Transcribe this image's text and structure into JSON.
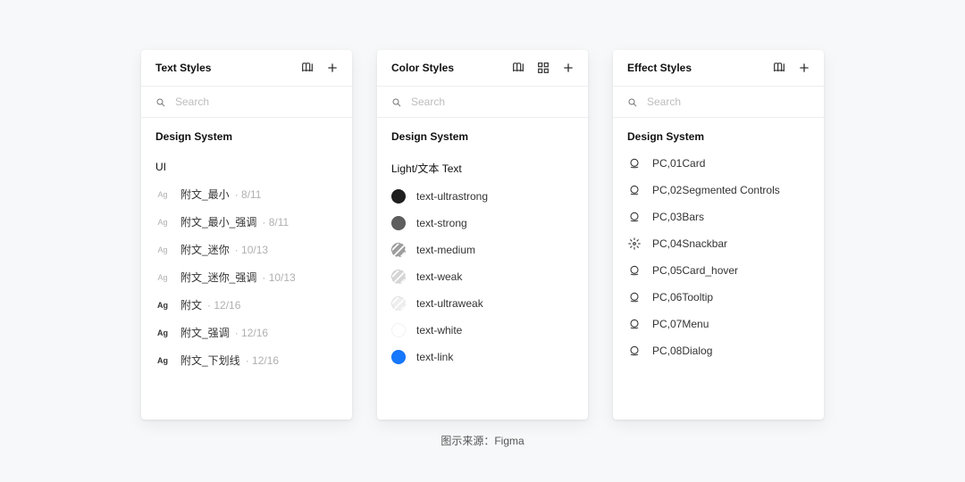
{
  "caption": "图示来源：Figma",
  "panels": {
    "text": {
      "title": "Text Styles",
      "searchPlaceholder": "Search",
      "section": "Design System",
      "group": "UI",
      "items": [
        {
          "name": "附文_最小",
          "meta": "8/11",
          "strong": false
        },
        {
          "name": "附文_最小_强调",
          "meta": "8/11",
          "strong": false
        },
        {
          "name": "附文_迷你",
          "meta": "10/13",
          "strong": false
        },
        {
          "name": "附文_迷你_强调",
          "meta": "10/13",
          "strong": false
        },
        {
          "name": "附文",
          "meta": "12/16",
          "strong": true
        },
        {
          "name": "附文_强调",
          "meta": "12/16",
          "strong": true
        },
        {
          "name": "附文_下划线",
          "meta": "12/16",
          "strong": true
        }
      ]
    },
    "color": {
      "title": "Color Styles",
      "searchPlaceholder": "Search",
      "section": "Design System",
      "group": "Light/文本 Text",
      "items": [
        {
          "name": "text-ultrastrong",
          "color": "#1f1f1f"
        },
        {
          "name": "text-strong",
          "color": "#5e5e5e"
        },
        {
          "name": "text-medium",
          "color": "#9e9e9e",
          "stripe": true
        },
        {
          "name": "text-weak",
          "color": "#d6d6d6",
          "stripe": true
        },
        {
          "name": "text-ultraweak",
          "color": "#eeeeee",
          "stripe": true
        },
        {
          "name": "text-white",
          "color": "#ffffff"
        },
        {
          "name": "text-link",
          "color": "#1677ff"
        }
      ]
    },
    "effect": {
      "title": "Effect Styles",
      "searchPlaceholder": "Search",
      "section": "Design System",
      "items": [
        {
          "name": "PC,01Card",
          "icon": "shadow"
        },
        {
          "name": "PC,02Segmented Controls",
          "icon": "shadow"
        },
        {
          "name": "PC,03Bars",
          "icon": "shadow"
        },
        {
          "name": "PC,04Snackbar",
          "icon": "blur"
        },
        {
          "name": "PC,05Card_hover",
          "icon": "shadow"
        },
        {
          "name": "PC,06Tooltip",
          "icon": "shadow"
        },
        {
          "name": "PC,07Menu",
          "icon": "shadow"
        },
        {
          "name": "PC,08Dialog",
          "icon": "shadow"
        }
      ]
    }
  }
}
